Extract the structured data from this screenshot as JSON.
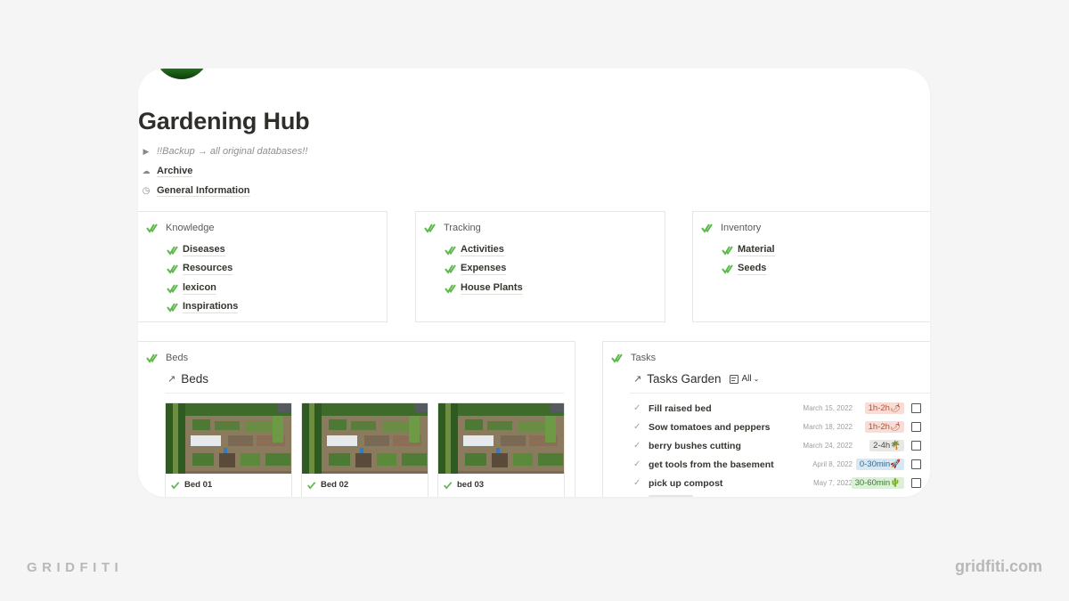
{
  "page": {
    "title": "Gardening Hub",
    "toggle_text": "!!Backup → all original databases!!",
    "links": [
      {
        "label": "Archive",
        "icon": "cloud-icon"
      },
      {
        "label": "General Information",
        "icon": "clock-icon"
      }
    ]
  },
  "sections": {
    "knowledge": {
      "title": "Knowledge",
      "items": [
        "Diseases",
        "Resources",
        "lexicon",
        "Inspirations"
      ]
    },
    "tracking": {
      "title": "Tracking",
      "items": [
        "Activities",
        "Expenses",
        "House Plants"
      ]
    },
    "inventory": {
      "title": "Inventory",
      "items": [
        "Material",
        "Seeds"
      ]
    }
  },
  "beds": {
    "section_title": "Beds",
    "view_title": "Beds",
    "cards": [
      {
        "name": "Bed 01"
      },
      {
        "name": "Bed 02"
      },
      {
        "name": "bed 03"
      }
    ]
  },
  "tasks": {
    "section_title": "Tasks",
    "view_title": "Tasks Garden",
    "view_selector": "All",
    "rows": [
      {
        "name": "Fill raised bed",
        "date": "March 15, 2022",
        "tag": "1h-2h🌶",
        "tag_color": "#f7ddd6",
        "tag_text_color": "#b5513a",
        "done": false
      },
      {
        "name": "Sow tomatoes and peppers",
        "date": "March 18, 2022",
        "tag": "1h-2h🌶",
        "tag_color": "#f7ddd6",
        "tag_text_color": "#b5513a",
        "done": false
      },
      {
        "name": "berry bushes cutting",
        "date": "March 24, 2022",
        "tag": "2-4h🌴",
        "tag_color": "#e8e8e6",
        "tag_text_color": "#4a4945",
        "done": false
      },
      {
        "name": "get tools from the basement",
        "date": "April 8, 2022",
        "tag": "0-30min🚀",
        "tag_color": "#d7e8f5",
        "tag_text_color": "#2e6a9b",
        "done": false
      },
      {
        "name": "pick up compost",
        "date": "May 7, 2022",
        "tag": "30-60min🌵",
        "tag_color": "#dcefd9",
        "tag_text_color": "#3d7a34",
        "done": false
      }
    ]
  },
  "branding": {
    "left": "GRIDFITI",
    "right": "gridfiti.com"
  },
  "colors": {
    "check_green": "#5cb84a",
    "background": "#f5f5f5"
  }
}
